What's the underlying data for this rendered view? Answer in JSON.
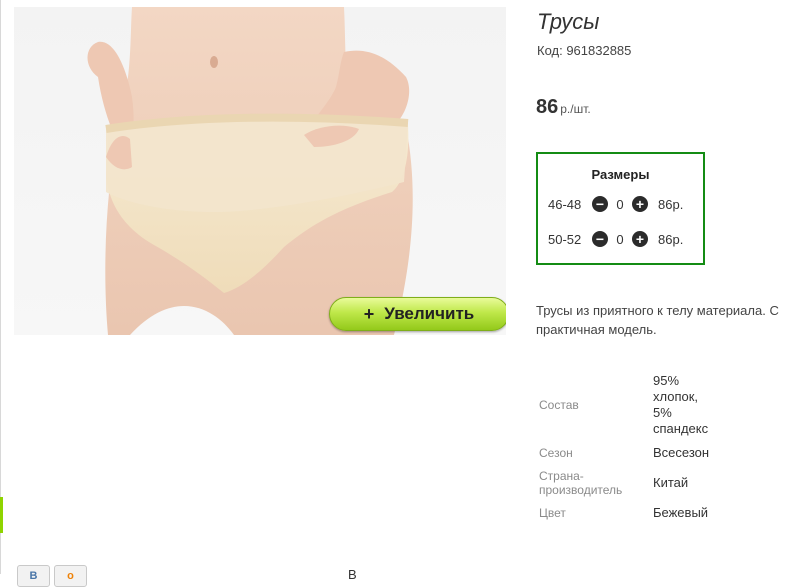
{
  "product": {
    "title": "Трусы",
    "code_label": "Код: 961832885",
    "price_value": "86",
    "price_unit": "р./шт."
  },
  "zoom_button": {
    "icon": "+",
    "label": "Увеличить"
  },
  "sizes": {
    "header": "Размеры",
    "rows": [
      {
        "size": "46-48",
        "qty": "0",
        "price": "86р."
      },
      {
        "size": "50-52",
        "qty": "0",
        "price": "86р."
      }
    ],
    "minus_glyph": "−",
    "plus_glyph": "+"
  },
  "description": {
    "line1": "Трусы из приятного к телу материала. С",
    "line2": "практичная модель."
  },
  "specs": [
    {
      "key": "Состав",
      "value": [
        "95%",
        "хлопок,",
        "5%",
        "спандекс"
      ]
    },
    {
      "key": "Сезон",
      "value": [
        "Всесезон"
      ]
    },
    {
      "key": [
        "Страна-",
        "производитель"
      ],
      "value": [
        "Китай"
      ]
    },
    {
      "key": "Цвет",
      "value": [
        "Бежевый"
      ]
    }
  ],
  "social": {
    "vk": "B",
    "ok": "o"
  },
  "bottom_cut_text": "В",
  "colors": {
    "frame_green": "#148c14",
    "button_green": "#bfe84a",
    "accent_tick": "#8fd400"
  },
  "icons": [
    "minus-circle-icon",
    "plus-circle-icon",
    "plus-icon",
    "vk-icon",
    "ok-icon"
  ]
}
